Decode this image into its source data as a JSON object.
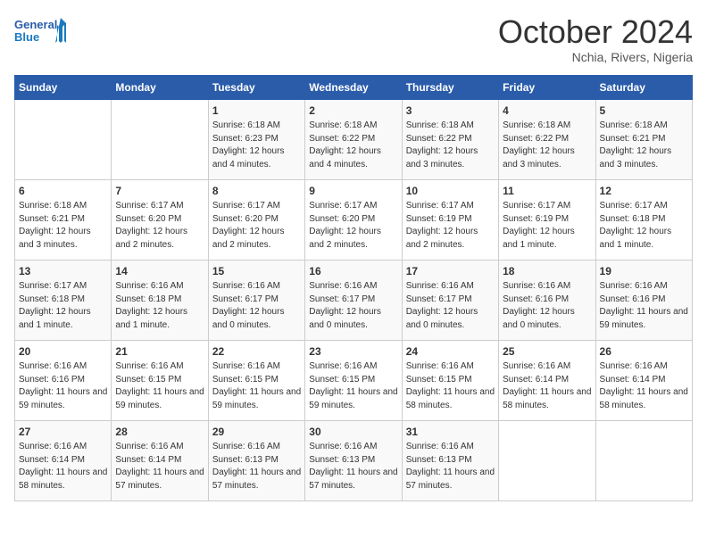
{
  "header": {
    "logo_line1": "General",
    "logo_line2": "Blue",
    "month_title": "October 2024",
    "location": "Nchia, Rivers, Nigeria"
  },
  "days_of_week": [
    "Sunday",
    "Monday",
    "Tuesday",
    "Wednesday",
    "Thursday",
    "Friday",
    "Saturday"
  ],
  "weeks": [
    [
      null,
      null,
      {
        "day": 1,
        "sunrise": "6:18 AM",
        "sunset": "6:23 PM",
        "daylight": "12 hours and 4 minutes."
      },
      {
        "day": 2,
        "sunrise": "6:18 AM",
        "sunset": "6:22 PM",
        "daylight": "12 hours and 4 minutes."
      },
      {
        "day": 3,
        "sunrise": "6:18 AM",
        "sunset": "6:22 PM",
        "daylight": "12 hours and 3 minutes."
      },
      {
        "day": 4,
        "sunrise": "6:18 AM",
        "sunset": "6:22 PM",
        "daylight": "12 hours and 3 minutes."
      },
      {
        "day": 5,
        "sunrise": "6:18 AM",
        "sunset": "6:21 PM",
        "daylight": "12 hours and 3 minutes."
      }
    ],
    [
      {
        "day": 6,
        "sunrise": "6:18 AM",
        "sunset": "6:21 PM",
        "daylight": "12 hours and 3 minutes."
      },
      {
        "day": 7,
        "sunrise": "6:17 AM",
        "sunset": "6:20 PM",
        "daylight": "12 hours and 2 minutes."
      },
      {
        "day": 8,
        "sunrise": "6:17 AM",
        "sunset": "6:20 PM",
        "daylight": "12 hours and 2 minutes."
      },
      {
        "day": 9,
        "sunrise": "6:17 AM",
        "sunset": "6:20 PM",
        "daylight": "12 hours and 2 minutes."
      },
      {
        "day": 10,
        "sunrise": "6:17 AM",
        "sunset": "6:19 PM",
        "daylight": "12 hours and 2 minutes."
      },
      {
        "day": 11,
        "sunrise": "6:17 AM",
        "sunset": "6:19 PM",
        "daylight": "12 hours and 1 minute."
      },
      {
        "day": 12,
        "sunrise": "6:17 AM",
        "sunset": "6:18 PM",
        "daylight": "12 hours and 1 minute."
      }
    ],
    [
      {
        "day": 13,
        "sunrise": "6:17 AM",
        "sunset": "6:18 PM",
        "daylight": "12 hours and 1 minute."
      },
      {
        "day": 14,
        "sunrise": "6:16 AM",
        "sunset": "6:18 PM",
        "daylight": "12 hours and 1 minute."
      },
      {
        "day": 15,
        "sunrise": "6:16 AM",
        "sunset": "6:17 PM",
        "daylight": "12 hours and 0 minutes."
      },
      {
        "day": 16,
        "sunrise": "6:16 AM",
        "sunset": "6:17 PM",
        "daylight": "12 hours and 0 minutes."
      },
      {
        "day": 17,
        "sunrise": "6:16 AM",
        "sunset": "6:17 PM",
        "daylight": "12 hours and 0 minutes."
      },
      {
        "day": 18,
        "sunrise": "6:16 AM",
        "sunset": "6:16 PM",
        "daylight": "12 hours and 0 minutes."
      },
      {
        "day": 19,
        "sunrise": "6:16 AM",
        "sunset": "6:16 PM",
        "daylight": "11 hours and 59 minutes."
      }
    ],
    [
      {
        "day": 20,
        "sunrise": "6:16 AM",
        "sunset": "6:16 PM",
        "daylight": "11 hours and 59 minutes."
      },
      {
        "day": 21,
        "sunrise": "6:16 AM",
        "sunset": "6:15 PM",
        "daylight": "11 hours and 59 minutes."
      },
      {
        "day": 22,
        "sunrise": "6:16 AM",
        "sunset": "6:15 PM",
        "daylight": "11 hours and 59 minutes."
      },
      {
        "day": 23,
        "sunrise": "6:16 AM",
        "sunset": "6:15 PM",
        "daylight": "11 hours and 59 minutes."
      },
      {
        "day": 24,
        "sunrise": "6:16 AM",
        "sunset": "6:15 PM",
        "daylight": "11 hours and 58 minutes."
      },
      {
        "day": 25,
        "sunrise": "6:16 AM",
        "sunset": "6:14 PM",
        "daylight": "11 hours and 58 minutes."
      },
      {
        "day": 26,
        "sunrise": "6:16 AM",
        "sunset": "6:14 PM",
        "daylight": "11 hours and 58 minutes."
      }
    ],
    [
      {
        "day": 27,
        "sunrise": "6:16 AM",
        "sunset": "6:14 PM",
        "daylight": "11 hours and 58 minutes."
      },
      {
        "day": 28,
        "sunrise": "6:16 AM",
        "sunset": "6:14 PM",
        "daylight": "11 hours and 57 minutes."
      },
      {
        "day": 29,
        "sunrise": "6:16 AM",
        "sunset": "6:13 PM",
        "daylight": "11 hours and 57 minutes."
      },
      {
        "day": 30,
        "sunrise": "6:16 AM",
        "sunset": "6:13 PM",
        "daylight": "11 hours and 57 minutes."
      },
      {
        "day": 31,
        "sunrise": "6:16 AM",
        "sunset": "6:13 PM",
        "daylight": "11 hours and 57 minutes."
      },
      null,
      null
    ]
  ],
  "labels": {
    "sunrise_label": "Sunrise:",
    "sunset_label": "Sunset:",
    "daylight_label": "Daylight:"
  }
}
